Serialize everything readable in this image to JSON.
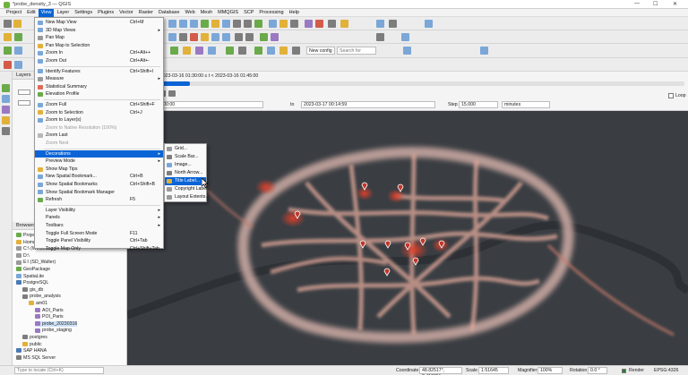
{
  "window": {
    "title": "*probe_density_3 — QGIS",
    "controls": [
      "—",
      "☐",
      "✕"
    ]
  },
  "menubar": [
    "Project",
    "Edit",
    "View",
    "Layer",
    "Settings",
    "Plugins",
    "Vector",
    "Raster",
    "Database",
    "Web",
    "Mesh",
    "MMQGIS",
    "SCP",
    "Processing",
    "Help"
  ],
  "toolbar": {
    "theme_select": "New config",
    "search_placeholder": "Search for"
  },
  "layers_panel": {
    "title": "Layers"
  },
  "browser_panel": {
    "title": "Browser",
    "items": [
      {
        "label": "Project Home",
        "indent": 0,
        "color": "#6aaa4a"
      },
      {
        "label": "Home",
        "indent": 0,
        "color": "#e2b13a"
      },
      {
        "label": "C:\\ (Windows)",
        "indent": 0,
        "color": "#9a9a9a"
      },
      {
        "label": "D:\\",
        "indent": 0,
        "color": "#9a9a9a"
      },
      {
        "label": "E:\\ (SD_Walter)",
        "indent": 0,
        "color": "#9a9a9a"
      },
      {
        "label": "GeoPackage",
        "indent": 0,
        "color": "#6aaa4a"
      },
      {
        "label": "SpatiaLite",
        "indent": 0,
        "color": "#7aa7d8"
      },
      {
        "label": "PostgreSQL",
        "indent": 0,
        "color": "#4b79b5"
      },
      {
        "label": "gis_db",
        "indent": 1,
        "color": "#7d7d7d"
      },
      {
        "label": "probe_analysis",
        "indent": 1,
        "color": "#7d7d7d"
      },
      {
        "label": "am01",
        "indent": 2,
        "color": "#e2b13a"
      },
      {
        "label": "AOI_Paris",
        "indent": 3,
        "color": "#9a79c2"
      },
      {
        "label": "POI_Paris",
        "indent": 3,
        "color": "#9a79c2"
      },
      {
        "label": "probe_20230316",
        "indent": 3,
        "color": "#9a79c2"
      },
      {
        "label": "probe_staging",
        "indent": 3,
        "color": "#9a79c2"
      },
      {
        "label": "postgres",
        "indent": 1,
        "color": "#7d7d7d"
      },
      {
        "label": "public",
        "indent": 1,
        "color": "#e2b13a"
      },
      {
        "label": "SAP HANA",
        "indent": 0,
        "color": "#4b79b5"
      },
      {
        "label": "MS SQL Server",
        "indent": 0,
        "color": "#7d7d7d"
      }
    ],
    "locator_placeholder": "Type to locate (Ctrl+K)"
  },
  "temporal": {
    "current_frame": "Current frame: 2023-03-16 01:30:00 ≤ t < 2023-03-16 01:45:00",
    "start": "2023-03-16 00:00:00",
    "to_label": "to",
    "end": "2023-03-17 00:14:59",
    "step_label": "Step",
    "step_value": "15.000",
    "step_unit": "minutes",
    "loop_label": "Loop",
    "progress": 0.11
  },
  "view_menu": [
    {
      "label": "New Map View",
      "shortcut": "Ctrl+M",
      "icon": "#7aa7d8"
    },
    {
      "label": "3D Map Views",
      "arrow": true,
      "icon": "#7aa7d8"
    },
    {
      "label": "Pan Map",
      "icon": "#9a9a9a"
    },
    {
      "label": "Pan Map to Selection",
      "icon": "#e2b13a"
    },
    {
      "label": "Zoom In",
      "shortcut": "Ctrl+Alt++",
      "icon": "#7aa7d8"
    },
    {
      "label": "Zoom Out",
      "shortcut": "Ctrl+Alt+-",
      "icon": "#7aa7d8"
    },
    {
      "sep": true
    },
    {
      "label": "Identify Features",
      "shortcut": "Ctrl+Shift+I",
      "icon": "#7aa7d8"
    },
    {
      "label": "Measure",
      "arrow": true,
      "icon": "#9a9a9a"
    },
    {
      "label": "Statistical Summary",
      "icon": "#e26a5a"
    },
    {
      "label": "Elevation Profile",
      "icon": "#6aaa4a"
    },
    {
      "sep": true
    },
    {
      "label": "Zoom Full",
      "shortcut": "Ctrl+Shift+F",
      "icon": "#7aa7d8"
    },
    {
      "label": "Zoom to Selection",
      "shortcut": "Ctrl+J",
      "icon": "#e2b13a"
    },
    {
      "label": "Zoom to Layer(s)",
      "icon": "#7aa7d8"
    },
    {
      "label": "Zoom to Native Resolution (100%)",
      "disabled": true
    },
    {
      "label": "Zoom Last",
      "icon": "#b8b8b8"
    },
    {
      "label": "Zoom Next",
      "disabled": true
    },
    {
      "sep": true
    },
    {
      "label": "Decorations",
      "arrow": true,
      "highlight": true
    },
    {
      "label": "Preview Mode",
      "arrow": true
    },
    {
      "label": "Show Map Tips",
      "icon": "#e2b13a"
    },
    {
      "label": "New Spatial Bookmark...",
      "shortcut": "Ctrl+B",
      "icon": "#7aa7d8"
    },
    {
      "label": "Show Spatial Bookmarks",
      "shortcut": "Ctrl+Shift+B",
      "icon": "#7aa7d8"
    },
    {
      "label": "Show Spatial Bookmark Manager",
      "icon": "#7aa7d8"
    },
    {
      "label": "Refresh",
      "shortcut": "F5",
      "icon": "#6aaa4a"
    },
    {
      "sep": true
    },
    {
      "label": "Layer Visibility",
      "arrow": true
    },
    {
      "label": "Panels",
      "arrow": true
    },
    {
      "label": "Toolbars",
      "arrow": true
    },
    {
      "label": "Toggle Full Screen Mode",
      "shortcut": "F11"
    },
    {
      "label": "Toggle Panel Visibility",
      "shortcut": "Ctrl+Tab"
    },
    {
      "label": "Toggle Map Only",
      "shortcut": "Ctrl+Shift+Tab"
    }
  ],
  "decorations_menu": [
    {
      "label": "Grid...",
      "icon": "#9a9a9a"
    },
    {
      "label": "Scale Bar...",
      "icon": "#7d7d7d"
    },
    {
      "label": "Image...",
      "icon": "#7aa7d8"
    },
    {
      "label": "North Arrow...",
      "icon": "#7d7d7d"
    },
    {
      "label": "Title Label...",
      "icon": "#e2b13a",
      "highlight": true
    },
    {
      "label": "Copyright Label...",
      "icon": "#9a9a9a"
    },
    {
      "label": "Layout Extents...",
      "icon": "#9a9a9a"
    }
  ],
  "statusbar": {
    "coordinate_label": "Coordinate",
    "coordinate": "48.82517°, 2.41035°",
    "scale_label": "Scale",
    "scale": "1:51645",
    "magnifier_label": "Magnifier",
    "magnifier": "100%",
    "rotation_label": "Rotation",
    "rotation": "0.0 °",
    "render_label": "Render",
    "crs": "EPSG:4326"
  },
  "colors": {
    "menu_highlight": "#0a64d6",
    "map_background": "#3b3f44",
    "heat_low": "#d8c8c4",
    "heat_high": "#e0402a",
    "marker": "#c0392b"
  }
}
